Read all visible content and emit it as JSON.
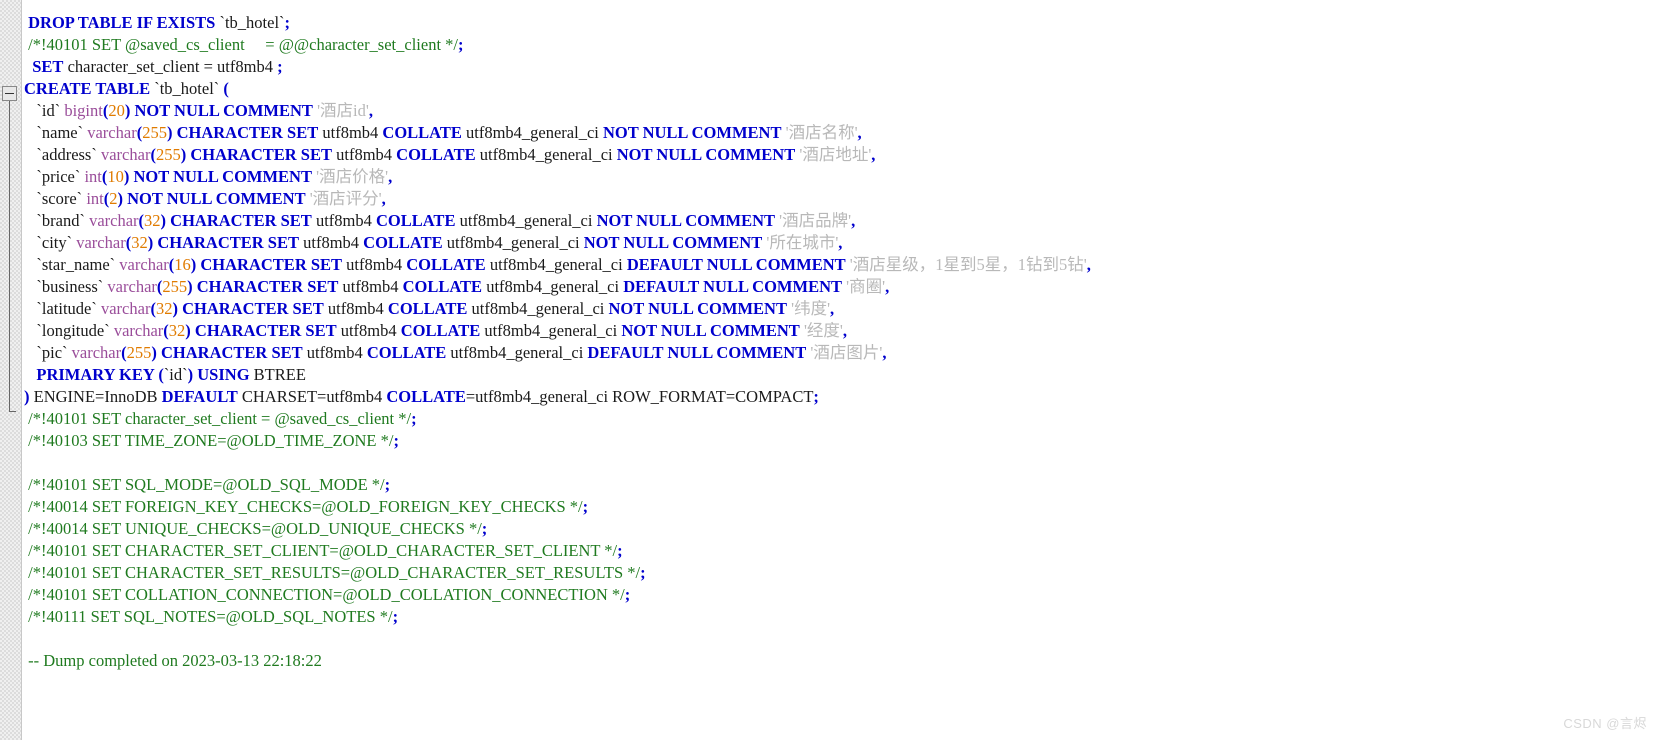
{
  "app": {
    "type": "sql-code-editor",
    "filename_context": "MySQL dump script"
  },
  "colors": {
    "keyword": "#0000cd",
    "comment": "#1f7a1f",
    "string": "#b8b8b8",
    "number": "#e07b00",
    "type": "#9a4d9a",
    "plain": "#1a1a1a",
    "background": "#ffffff",
    "gutter": "#f0f0f0"
  },
  "gutter": {
    "fold_marker": "collapse-minus",
    "fold_start_line": 4,
    "fold_end_line": 20
  },
  "watermark": {
    "text": "CSDN @言烬"
  },
  "code": {
    "lines": [
      [
        {
          "t": " ",
          "c": "plain"
        },
        {
          "t": "DROP TABLE IF EXISTS",
          "c": "kw"
        },
        {
          "t": " `tb_hotel`",
          "c": "bt"
        },
        {
          "t": ";",
          "c": "punc"
        }
      ],
      [
        {
          "t": " /*!40101 ",
          "c": "cmt"
        },
        {
          "t": "SET",
          "c": "cmt"
        },
        {
          "t": " @saved_cs_client     = @@character_set_client */",
          "c": "cmt"
        },
        {
          "t": ";",
          "c": "punc"
        }
      ],
      [
        {
          "t": "  ",
          "c": "plain"
        },
        {
          "t": "SET",
          "c": "kw"
        },
        {
          "t": " character_set_client = utf8mb4 ",
          "c": "plain"
        },
        {
          "t": ";",
          "c": "punc"
        }
      ],
      [
        {
          "t": "CREATE TABLE",
          "c": "kw"
        },
        {
          "t": " `tb_hotel` ",
          "c": "bt"
        },
        {
          "t": "(",
          "c": "punc"
        }
      ],
      [
        {
          "t": "   `id` ",
          "c": "bt"
        },
        {
          "t": "bigint",
          "c": "type"
        },
        {
          "t": "(",
          "c": "punc"
        },
        {
          "t": "20",
          "c": "num"
        },
        {
          "t": ")",
          "c": "punc"
        },
        {
          "t": " ",
          "c": "plain"
        },
        {
          "t": "NOT NULL COMMENT",
          "c": "kw"
        },
        {
          "t": " '酒店id'",
          "c": "str"
        },
        {
          "t": ",",
          "c": "punc"
        }
      ],
      [
        {
          "t": "   `name` ",
          "c": "bt"
        },
        {
          "t": "varchar",
          "c": "type"
        },
        {
          "t": "(",
          "c": "punc"
        },
        {
          "t": "255",
          "c": "num"
        },
        {
          "t": ")",
          "c": "punc"
        },
        {
          "t": " ",
          "c": "plain"
        },
        {
          "t": "CHARACTER SET",
          "c": "kw"
        },
        {
          "t": " utf8mb4 ",
          "c": "plain"
        },
        {
          "t": "COLLATE",
          "c": "kw"
        },
        {
          "t": " utf8mb4_general_ci ",
          "c": "plain"
        },
        {
          "t": "NOT NULL COMMENT",
          "c": "kw"
        },
        {
          "t": " '酒店名称'",
          "c": "str"
        },
        {
          "t": ",",
          "c": "punc"
        }
      ],
      [
        {
          "t": "   `address` ",
          "c": "bt"
        },
        {
          "t": "varchar",
          "c": "type"
        },
        {
          "t": "(",
          "c": "punc"
        },
        {
          "t": "255",
          "c": "num"
        },
        {
          "t": ")",
          "c": "punc"
        },
        {
          "t": " ",
          "c": "plain"
        },
        {
          "t": "CHARACTER SET",
          "c": "kw"
        },
        {
          "t": " utf8mb4 ",
          "c": "plain"
        },
        {
          "t": "COLLATE",
          "c": "kw"
        },
        {
          "t": " utf8mb4_general_ci ",
          "c": "plain"
        },
        {
          "t": "NOT NULL COMMENT",
          "c": "kw"
        },
        {
          "t": " '酒店地址'",
          "c": "str"
        },
        {
          "t": ",",
          "c": "punc"
        }
      ],
      [
        {
          "t": "   `price` ",
          "c": "bt"
        },
        {
          "t": "int",
          "c": "type"
        },
        {
          "t": "(",
          "c": "punc"
        },
        {
          "t": "10",
          "c": "num"
        },
        {
          "t": ")",
          "c": "punc"
        },
        {
          "t": " ",
          "c": "plain"
        },
        {
          "t": "NOT NULL COMMENT",
          "c": "kw"
        },
        {
          "t": " '酒店价格'",
          "c": "str"
        },
        {
          "t": ",",
          "c": "punc"
        }
      ],
      [
        {
          "t": "   `score` ",
          "c": "bt"
        },
        {
          "t": "int",
          "c": "type"
        },
        {
          "t": "(",
          "c": "punc"
        },
        {
          "t": "2",
          "c": "num"
        },
        {
          "t": ")",
          "c": "punc"
        },
        {
          "t": " ",
          "c": "plain"
        },
        {
          "t": "NOT NULL COMMENT",
          "c": "kw"
        },
        {
          "t": " '酒店评分'",
          "c": "str"
        },
        {
          "t": ",",
          "c": "punc"
        }
      ],
      [
        {
          "t": "   `brand` ",
          "c": "bt"
        },
        {
          "t": "varchar",
          "c": "type"
        },
        {
          "t": "(",
          "c": "punc"
        },
        {
          "t": "32",
          "c": "num"
        },
        {
          "t": ")",
          "c": "punc"
        },
        {
          "t": " ",
          "c": "plain"
        },
        {
          "t": "CHARACTER SET",
          "c": "kw"
        },
        {
          "t": " utf8mb4 ",
          "c": "plain"
        },
        {
          "t": "COLLATE",
          "c": "kw"
        },
        {
          "t": " utf8mb4_general_ci ",
          "c": "plain"
        },
        {
          "t": "NOT NULL COMMENT",
          "c": "kw"
        },
        {
          "t": " '酒店品牌'",
          "c": "str"
        },
        {
          "t": ",",
          "c": "punc"
        }
      ],
      [
        {
          "t": "   `city` ",
          "c": "bt"
        },
        {
          "t": "varchar",
          "c": "type"
        },
        {
          "t": "(",
          "c": "punc"
        },
        {
          "t": "32",
          "c": "num"
        },
        {
          "t": ")",
          "c": "punc"
        },
        {
          "t": " ",
          "c": "plain"
        },
        {
          "t": "CHARACTER SET",
          "c": "kw"
        },
        {
          "t": " utf8mb4 ",
          "c": "plain"
        },
        {
          "t": "COLLATE",
          "c": "kw"
        },
        {
          "t": " utf8mb4_general_ci ",
          "c": "plain"
        },
        {
          "t": "NOT NULL COMMENT",
          "c": "kw"
        },
        {
          "t": " '所在城市'",
          "c": "str"
        },
        {
          "t": ",",
          "c": "punc"
        }
      ],
      [
        {
          "t": "   `star_name` ",
          "c": "bt"
        },
        {
          "t": "varchar",
          "c": "type"
        },
        {
          "t": "(",
          "c": "punc"
        },
        {
          "t": "16",
          "c": "num"
        },
        {
          "t": ")",
          "c": "punc"
        },
        {
          "t": " ",
          "c": "plain"
        },
        {
          "t": "CHARACTER SET",
          "c": "kw"
        },
        {
          "t": " utf8mb4 ",
          "c": "plain"
        },
        {
          "t": "COLLATE",
          "c": "kw"
        },
        {
          "t": " utf8mb4_general_ci ",
          "c": "plain"
        },
        {
          "t": "DEFAULT NULL COMMENT",
          "c": "kw"
        },
        {
          "t": " '酒店星级，1星到5星，1钻到5钻'",
          "c": "str"
        },
        {
          "t": ",",
          "c": "punc"
        }
      ],
      [
        {
          "t": "   `business` ",
          "c": "bt"
        },
        {
          "t": "varchar",
          "c": "type"
        },
        {
          "t": "(",
          "c": "punc"
        },
        {
          "t": "255",
          "c": "num"
        },
        {
          "t": ")",
          "c": "punc"
        },
        {
          "t": " ",
          "c": "plain"
        },
        {
          "t": "CHARACTER SET",
          "c": "kw"
        },
        {
          "t": " utf8mb4 ",
          "c": "plain"
        },
        {
          "t": "COLLATE",
          "c": "kw"
        },
        {
          "t": " utf8mb4_general_ci ",
          "c": "plain"
        },
        {
          "t": "DEFAULT NULL COMMENT",
          "c": "kw"
        },
        {
          "t": " '商圈'",
          "c": "str"
        },
        {
          "t": ",",
          "c": "punc"
        }
      ],
      [
        {
          "t": "   `latitude` ",
          "c": "bt"
        },
        {
          "t": "varchar",
          "c": "type"
        },
        {
          "t": "(",
          "c": "punc"
        },
        {
          "t": "32",
          "c": "num"
        },
        {
          "t": ")",
          "c": "punc"
        },
        {
          "t": " ",
          "c": "plain"
        },
        {
          "t": "CHARACTER SET",
          "c": "kw"
        },
        {
          "t": " utf8mb4 ",
          "c": "plain"
        },
        {
          "t": "COLLATE",
          "c": "kw"
        },
        {
          "t": " utf8mb4_general_ci ",
          "c": "plain"
        },
        {
          "t": "NOT NULL COMMENT",
          "c": "kw"
        },
        {
          "t": " '纬度'",
          "c": "str"
        },
        {
          "t": ",",
          "c": "punc"
        }
      ],
      [
        {
          "t": "   `longitude` ",
          "c": "bt"
        },
        {
          "t": "varchar",
          "c": "type"
        },
        {
          "t": "(",
          "c": "punc"
        },
        {
          "t": "32",
          "c": "num"
        },
        {
          "t": ")",
          "c": "punc"
        },
        {
          "t": " ",
          "c": "plain"
        },
        {
          "t": "CHARACTER SET",
          "c": "kw"
        },
        {
          "t": " utf8mb4 ",
          "c": "plain"
        },
        {
          "t": "COLLATE",
          "c": "kw"
        },
        {
          "t": " utf8mb4_general_ci ",
          "c": "plain"
        },
        {
          "t": "NOT NULL COMMENT",
          "c": "kw"
        },
        {
          "t": " '经度'",
          "c": "str"
        },
        {
          "t": ",",
          "c": "punc"
        }
      ],
      [
        {
          "t": "   `pic` ",
          "c": "bt"
        },
        {
          "t": "varchar",
          "c": "type"
        },
        {
          "t": "(",
          "c": "punc"
        },
        {
          "t": "255",
          "c": "num"
        },
        {
          "t": ")",
          "c": "punc"
        },
        {
          "t": " ",
          "c": "plain"
        },
        {
          "t": "CHARACTER SET",
          "c": "kw"
        },
        {
          "t": " utf8mb4 ",
          "c": "plain"
        },
        {
          "t": "COLLATE",
          "c": "kw"
        },
        {
          "t": " utf8mb4_general_ci ",
          "c": "plain"
        },
        {
          "t": "DEFAULT NULL COMMENT",
          "c": "kw"
        },
        {
          "t": " '酒店图片'",
          "c": "str"
        },
        {
          "t": ",",
          "c": "punc"
        }
      ],
      [
        {
          "t": "   ",
          "c": "plain"
        },
        {
          "t": "PRIMARY KEY",
          "c": "kw"
        },
        {
          "t": " (",
          "c": "punc"
        },
        {
          "t": "`id`",
          "c": "bt"
        },
        {
          "t": ") ",
          "c": "punc"
        },
        {
          "t": "USING",
          "c": "kw"
        },
        {
          "t": " BTREE",
          "c": "plain"
        }
      ],
      [
        {
          "t": ")",
          "c": "punc"
        },
        {
          "t": " ENGINE=InnoDB ",
          "c": "plain"
        },
        {
          "t": "DEFAULT",
          "c": "kw"
        },
        {
          "t": " CHARSET=utf8mb4 ",
          "c": "plain"
        },
        {
          "t": "COLLATE",
          "c": "kw"
        },
        {
          "t": "=utf8mb4_general_ci ROW_FORMAT=COMPACT",
          "c": "plain"
        },
        {
          "t": ";",
          "c": "punc"
        }
      ],
      [
        {
          "t": " /*!40101 SET character_set_client = @saved_cs_client */",
          "c": "cmt"
        },
        {
          "t": ";",
          "c": "punc"
        }
      ],
      [
        {
          "t": " /*!40103 SET TIME_ZONE=@OLD_TIME_ZONE */",
          "c": "cmt"
        },
        {
          "t": ";",
          "c": "punc"
        }
      ],
      [],
      [
        {
          "t": " /*!40101 SET SQL_MODE=@OLD_SQL_MODE */",
          "c": "cmt"
        },
        {
          "t": ";",
          "c": "punc"
        }
      ],
      [
        {
          "t": " /*!40014 SET FOREIGN_KEY_CHECKS=@OLD_FOREIGN_KEY_CHECKS */",
          "c": "cmt"
        },
        {
          "t": ";",
          "c": "punc"
        }
      ],
      [
        {
          "t": " /*!40014 SET UNIQUE_CHECKS=@OLD_UNIQUE_CHECKS */",
          "c": "cmt"
        },
        {
          "t": ";",
          "c": "punc"
        }
      ],
      [
        {
          "t": " /*!40101 SET CHARACTER_SET_CLIENT=@OLD_CHARACTER_SET_CLIENT */",
          "c": "cmt"
        },
        {
          "t": ";",
          "c": "punc"
        }
      ],
      [
        {
          "t": " /*!40101 SET CHARACTER_SET_RESULTS=@OLD_CHARACTER_SET_RESULTS */",
          "c": "cmt"
        },
        {
          "t": ";",
          "c": "punc"
        }
      ],
      [
        {
          "t": " /*!40101 SET COLLATION_CONNECTION=@OLD_COLLATION_CONNECTION */",
          "c": "cmt"
        },
        {
          "t": ";",
          "c": "punc"
        }
      ],
      [
        {
          "t": " /*!40111 SET SQL_NOTES=@OLD_SQL_NOTES */",
          "c": "cmt"
        },
        {
          "t": ";",
          "c": "punc"
        }
      ],
      [],
      [
        {
          "t": " -- Dump completed on 2023-03-13 22:18:22",
          "c": "cmt"
        }
      ]
    ]
  }
}
